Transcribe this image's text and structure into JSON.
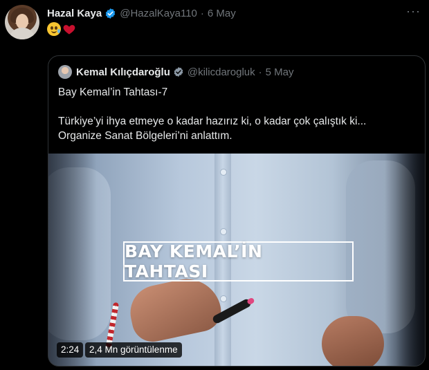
{
  "tweet": {
    "author_name": "Hazal Kaya",
    "author_handle": "@HazalKaya110",
    "separator": "·",
    "date": "6 May",
    "more_label": "···",
    "emojis": [
      "crying-face-emoji",
      "red-heart-emoji"
    ]
  },
  "quoted": {
    "author_name": "Kemal Kılıçdaroğlu",
    "author_handle": "@kilicdarogluk",
    "separator": "·",
    "date": "5 May",
    "text_line1": "Bay Kemal’in Tahtası-7",
    "text_line2": "Türkiye’yi ihya etmeye o kadar hazırız ki, o kadar çok çalıştık ki...",
    "text_line3": "Organize Sanat Bölgeleri’ni anlattım.",
    "video": {
      "overlay_title": "BAY KEMAL’İN TAHTASI",
      "duration": "2:24",
      "views": "2,4 Mn görüntülenme"
    }
  },
  "colors": {
    "background": "#000000",
    "text_primary": "#e7e9ea",
    "text_secondary": "#71767b",
    "verified_blue": "#1d9bf0",
    "border": "#2f3336"
  }
}
